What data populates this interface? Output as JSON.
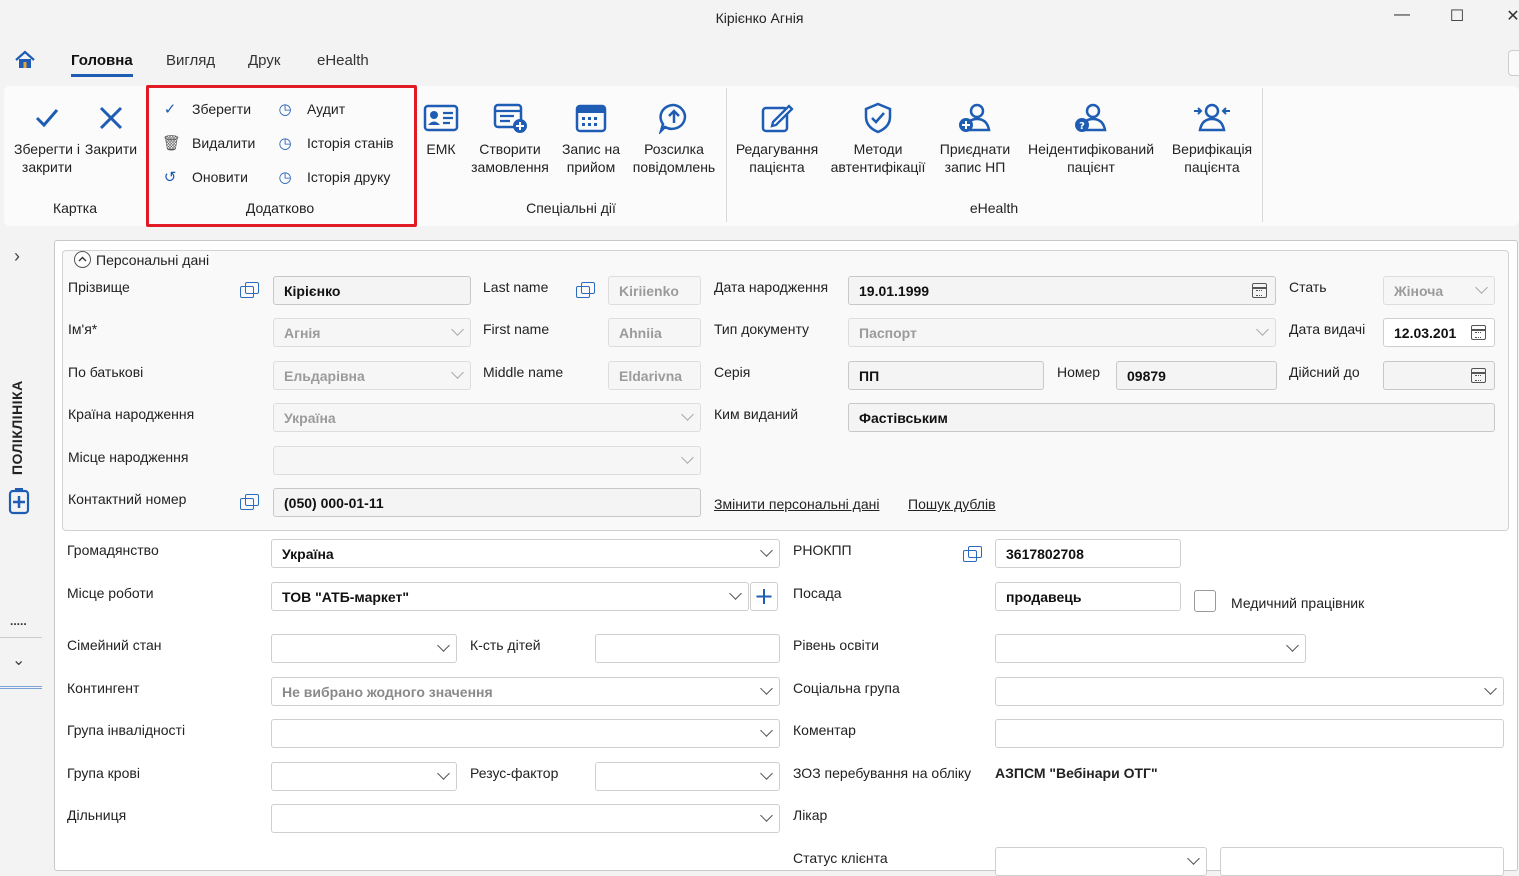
{
  "window": {
    "title": "Кірієнко Агнія",
    "minimize": "—",
    "maximize": "☐",
    "close": "✕"
  },
  "tabs": {
    "home_icon": "home-icon",
    "main": "Головна",
    "view": "Вигляд",
    "print": "Друк",
    "ehealth": "eHealth"
  },
  "ribbon": {
    "save_close": "Зберегти і закрити",
    "close": "Закрити",
    "group_card": "Картка",
    "save": "Зберегти",
    "delete": "Видалити",
    "refresh": "Оновити",
    "audit": "Аудит",
    "state_history": "Історія станів",
    "print_history": "Історія друку",
    "group_extra": "Додатково",
    "emk": "ЕМК",
    "create_order": "Створити замовлення",
    "appointment": "Запис на прийом",
    "mailing": "Розсилка повідомлень",
    "group_special": "Спеціальні дії",
    "edit_patient": "Редагування пацієнта",
    "auth_methods": "Методи автентифікації",
    "attach_np": "Приєднати запис НП",
    "unidentified": "Неідентифікований пацієнт",
    "verify": "Верифікація пацієнта",
    "group_ehealth": "eHealth"
  },
  "sidebar": {
    "expand": "›",
    "clinic": "ПОЛІКЛІНІКА",
    "dots": ".....",
    "collapse": "⌄"
  },
  "personal": {
    "header": "Персональні дані",
    "surname_label": "Прізвище",
    "surname": "Кірієнко",
    "name_label": "Ім'я*",
    "name": "Агнія",
    "patronymic_label": "По батькові",
    "patronymic": "Ельдарівна",
    "country_label": "Країна народження",
    "country": "Україна",
    "birthplace_label": "Місце народження",
    "birthplace": "",
    "phone_label": "Контактний номер",
    "phone": "(050) 000-01-11",
    "lastname_label": "Last name",
    "lastname": "Kiriienko",
    "firstname_label": "First name",
    "firstname": "Ahniia",
    "middlename_label": "Middle name",
    "middlename": "Eldarivna",
    "birthdate_label": "Дата народження",
    "birthdate": "19.01.1999",
    "doctype_label": "Тип документу",
    "doctype": "Паспорт",
    "series_label": "Серія",
    "series": "ПП",
    "number_label": "Номер",
    "number": "09879",
    "issuer_label": "Ким виданий",
    "issuer": "Фастівським",
    "sex_label": "Стать",
    "sex": "Жіноча",
    "issue_date_label": "Дата видачі",
    "issue_date": "12.03.201",
    "valid_label": "Дійсний до",
    "valid": "",
    "change_link": "Змінити персональні дані",
    "duplicates_link": "Пошук дублів"
  },
  "details": {
    "citizenship_label": "Громадянство",
    "citizenship": "Україна",
    "workplace_label": "Місце роботи",
    "workplace": "ТОВ \"АТБ-маркет\"",
    "marital_label": "Сімейний стан",
    "marital": "",
    "children_label": "К-сть дітей",
    "children": "",
    "contingent_label": "Контингент",
    "contingent": "Не вибрано жодного значення",
    "disability_label": "Група інвалідності",
    "disability": "",
    "blood_label": "Група крові",
    "blood": "",
    "rhesus_label": "Резус-фактор",
    "rhesus": "",
    "district_label": "Дільниця",
    "district": "",
    "rnokpp_label": "РНОКПП",
    "rnokpp": "3617802708",
    "position_label": "Посада",
    "position": "продавець",
    "medic_label": "Медичний працівник",
    "education_label": "Рівень освіти",
    "education": "",
    "social_label": "Соціальна група",
    "social": "",
    "comment_label": "Коментар",
    "comment": "",
    "zoz_label": "ЗОЗ перебування на обліку",
    "zoz": "АЗПСМ \"Вебінари ОТГ\"",
    "doctor_label": "Лікар",
    "client_status_label": "Статус клієнта",
    "client_status": ""
  }
}
